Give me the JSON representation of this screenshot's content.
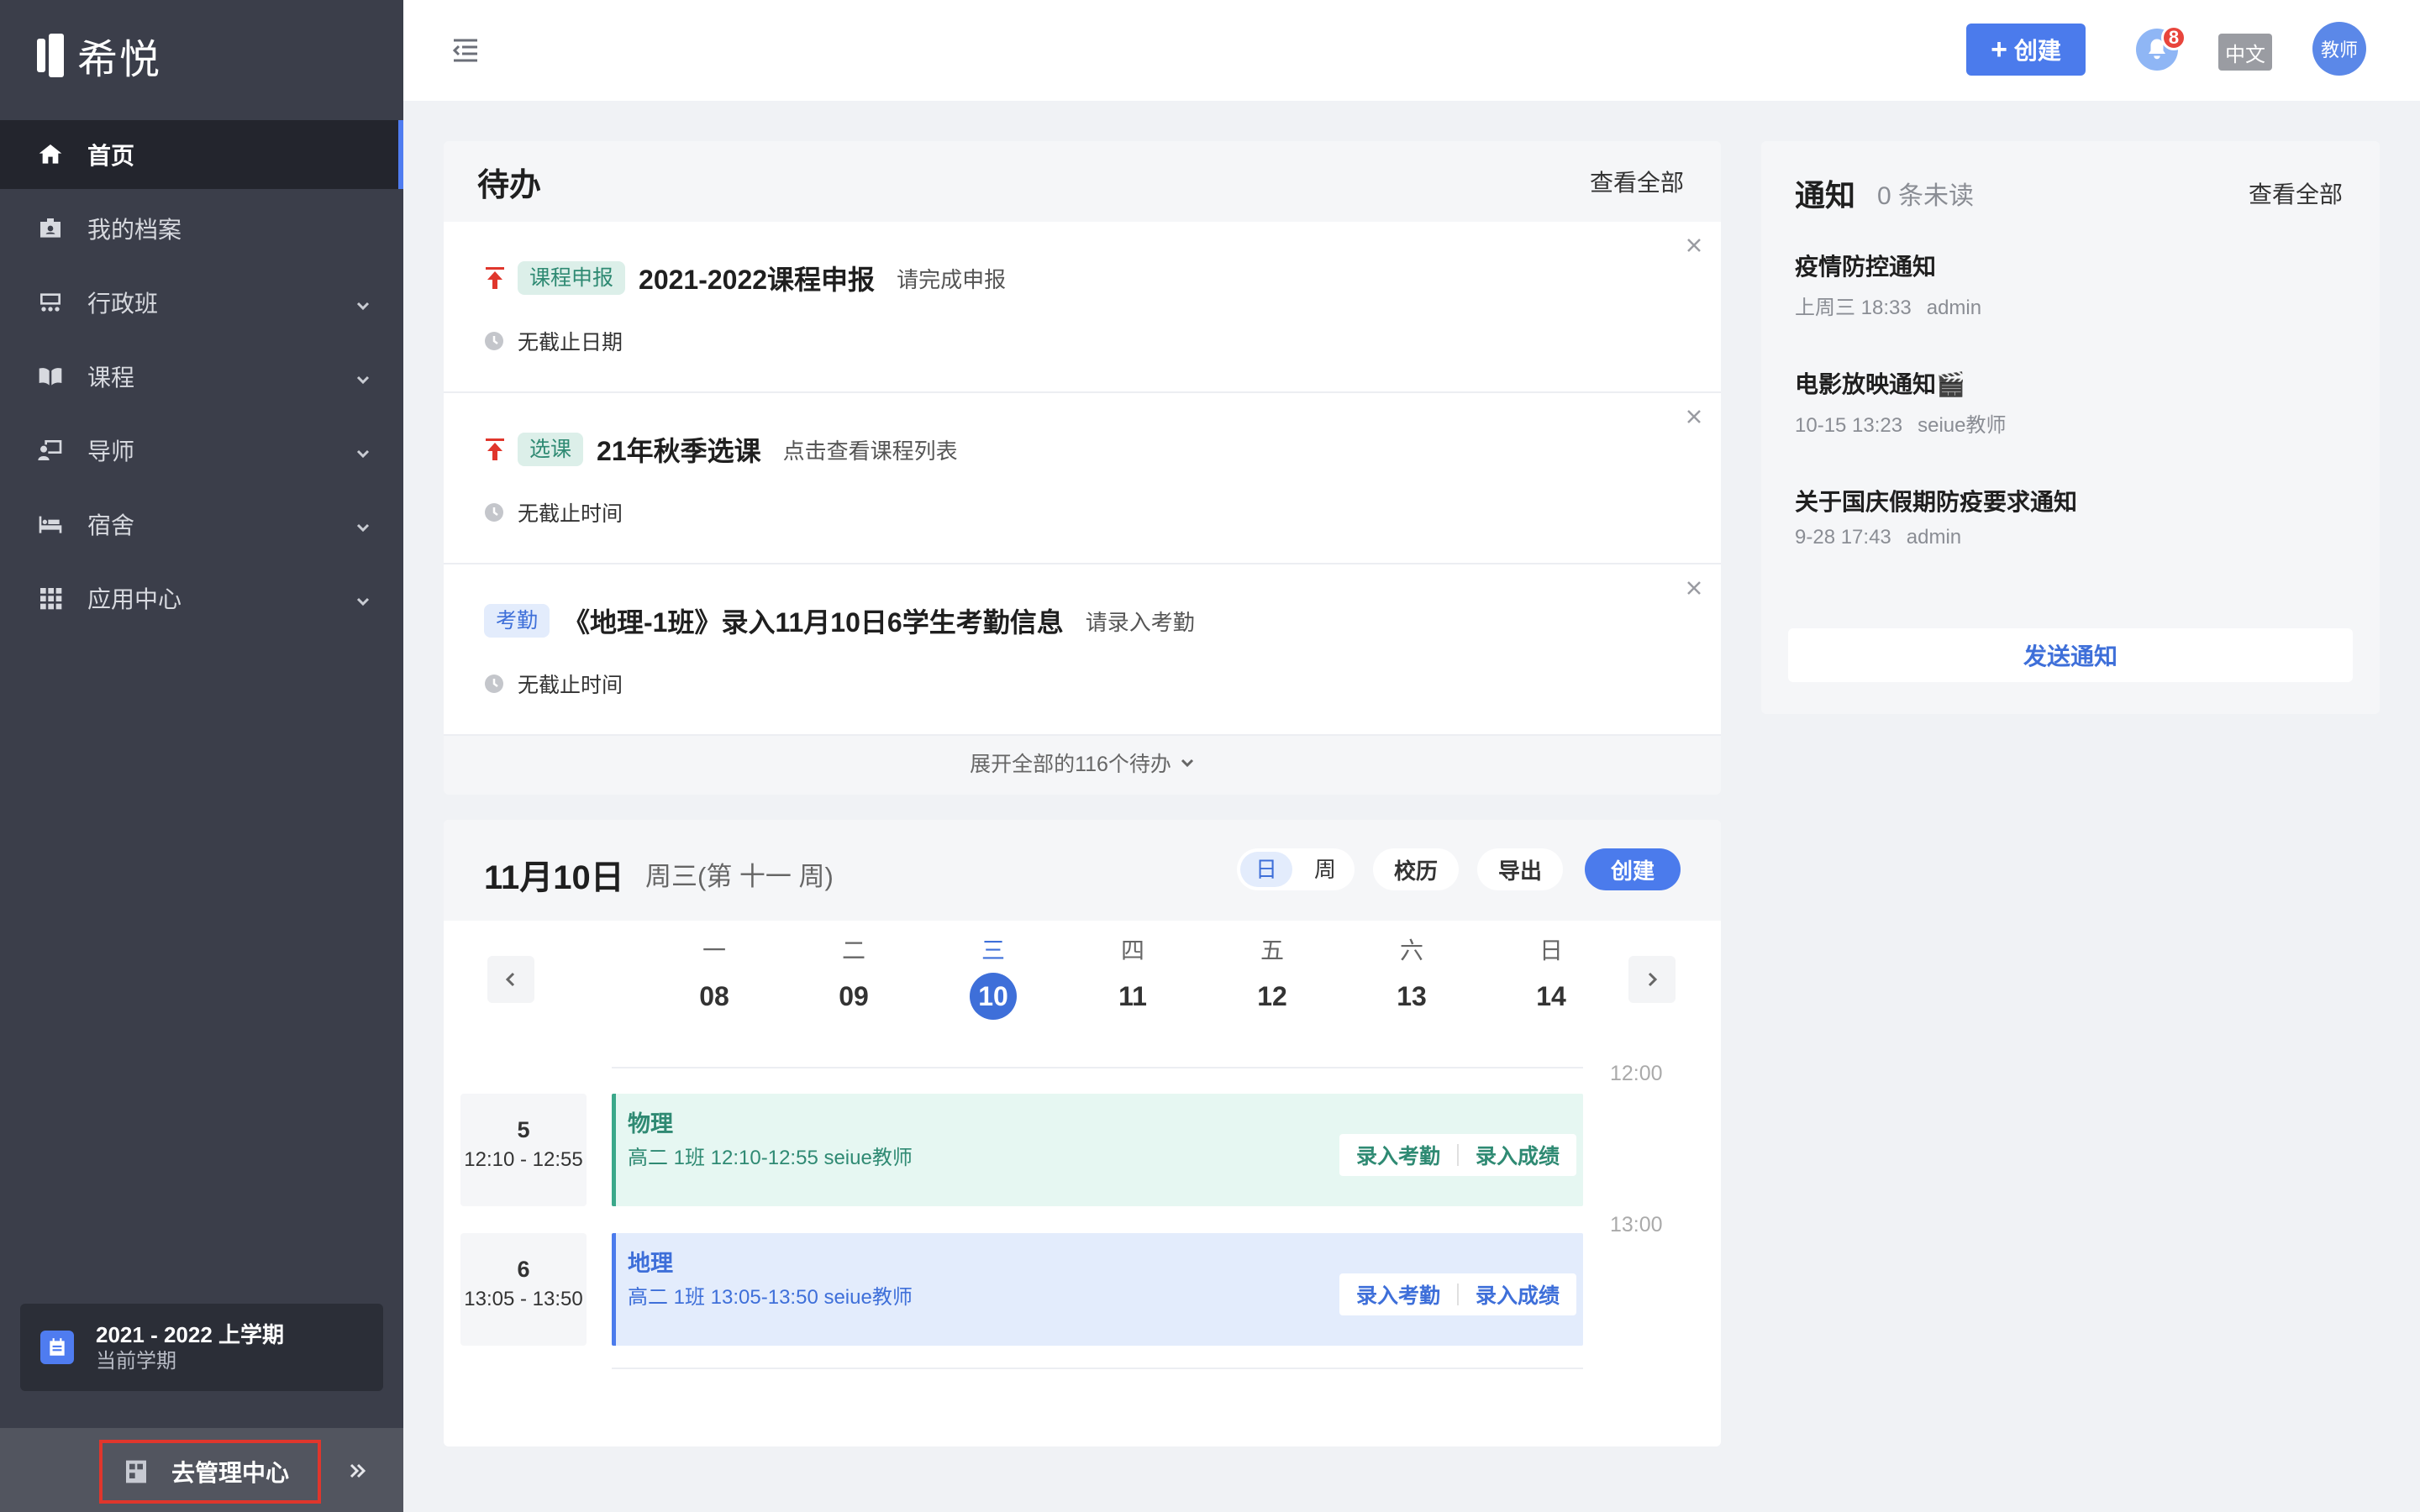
{
  "brand": {
    "name": "希悦"
  },
  "sidebar": {
    "items": [
      {
        "label": "首页",
        "icon": "home-icon",
        "active": true,
        "expandable": false
      },
      {
        "label": "我的档案",
        "icon": "profile-icon",
        "expandable": false
      },
      {
        "label": "行政班",
        "icon": "class-icon",
        "expandable": true
      },
      {
        "label": "课程",
        "icon": "book-icon",
        "expandable": true
      },
      {
        "label": "导师",
        "icon": "mentor-icon",
        "expandable": true
      },
      {
        "label": "宿舍",
        "icon": "bed-icon",
        "expandable": true
      },
      {
        "label": "应用中心",
        "icon": "apps-grid-icon",
        "expandable": true
      }
    ],
    "term": {
      "title": "2021 - 2022 上学期",
      "subtitle": "当前学期"
    },
    "admin_label": "去管理中心"
  },
  "header": {
    "create_label": "创建",
    "notification_count": "8",
    "language": "中文",
    "avatar_label": "教师"
  },
  "todo": {
    "title": "待办",
    "view_all": "查看全部",
    "items": [
      {
        "priority": "high",
        "tag": "课程申报",
        "title": "2021-2022课程申报",
        "hint": "请完成申报",
        "due": "无截止日期"
      },
      {
        "priority": "high",
        "tag": "选课",
        "title": "21年秋季选课",
        "hint": "点击查看课程列表",
        "due": "无截止时间"
      },
      {
        "priority": "none",
        "tag": "考勤",
        "title": "《地理-1班》录入11月10日6学生考勤信息",
        "hint": "请录入考勤",
        "due": "无截止时间"
      }
    ],
    "expand_label": "展开全部的116个待办"
  },
  "notice": {
    "title": "通知",
    "unread": "0 条未读",
    "view_all": "查看全部",
    "items": [
      {
        "title": "疫情防控通知",
        "time": "上周三 18:33",
        "author": "admin"
      },
      {
        "title": "电影放映通知🎬",
        "time": "10-15 13:23",
        "author": "seiue教师"
      },
      {
        "title": "关于国庆假期防疫要求通知",
        "time": "9-28 17:43",
        "author": "admin"
      }
    ],
    "send_label": "发送通知"
  },
  "calendar": {
    "date": "11月10日",
    "week_label": "周三(第 十一 周)",
    "view_day": "日",
    "view_week": "周",
    "ledger": "校历",
    "export": "导出",
    "create": "创建",
    "days": [
      {
        "dow": "一",
        "num": "08"
      },
      {
        "dow": "二",
        "num": "09"
      },
      {
        "dow": "三",
        "num": "10",
        "today": true
      },
      {
        "dow": "四",
        "num": "11"
      },
      {
        "dow": "五",
        "num": "12"
      },
      {
        "dow": "六",
        "num": "13"
      },
      {
        "dow": "日",
        "num": "14"
      }
    ],
    "times": [
      "12:00",
      "13:00"
    ],
    "lessons": [
      {
        "period": "5",
        "period_time": "12:10 - 12:55",
        "name": "物理",
        "info": "高二  1班   12:10-12:55   seiue教师",
        "color": "#3aa88a",
        "attend": "录入考勤",
        "grade": "录入成绩"
      },
      {
        "period": "6",
        "period_time": "13:05 - 13:50",
        "name": "地理",
        "info": "高二  1班   13:05-13:50   seiue教师",
        "color": "#4b7bec",
        "attend": "录入考勤",
        "grade": "录入成绩"
      }
    ]
  },
  "colors": {
    "accent": "#4b7bec",
    "sidebar_bg": "#3b3e4a",
    "danger": "#e8453c",
    "green": "#3aa88a"
  }
}
